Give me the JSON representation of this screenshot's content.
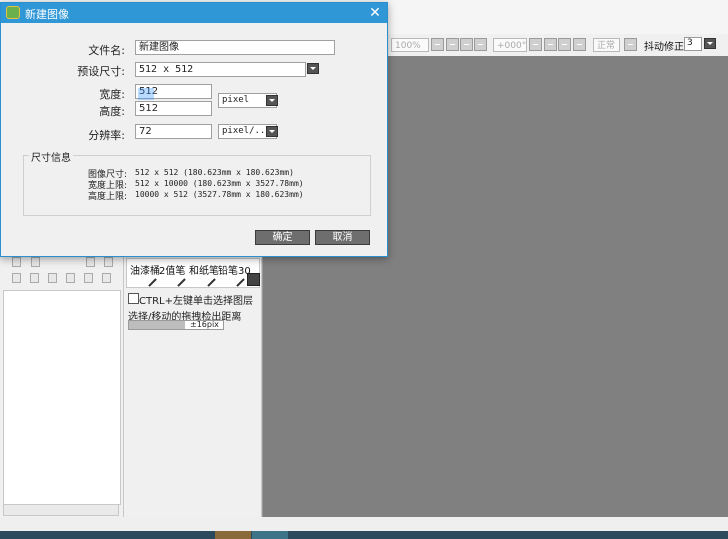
{
  "background": {
    "toolbar": {
      "zoom_value": "100%",
      "angle_value": "+000°",
      "mode_label": "正常",
      "stabilizer_label": "抖动修正",
      "stabilizer_value": "3"
    },
    "tool_labels": [
      "油漆桶",
      "2值笔",
      "和纸笔",
      "铅笔30"
    ],
    "ctrl_click_label": "CTRL+左键单击选择图层",
    "drag_distance_label": "选择/移动的拖拽检出距离",
    "drag_distance_value": "±16pix",
    "drag_distance_level": 0.6
  },
  "dialog": {
    "title": "新建图像",
    "close_glyph": "✕",
    "filename_label": "文件名:",
    "filename_value": "新建图像",
    "preset_label": "预设尺寸:",
    "preset_value": "512 x  512",
    "width_label": "宽度:",
    "width_value": "512",
    "height_label": "高度:",
    "height_value": "512",
    "unit_value": "pixel",
    "resolution_label": "分辨率:",
    "resolution_value": "72",
    "resolution_unit_value": "pixel/...",
    "size_info": {
      "title": "尺寸信息",
      "rows": [
        {
          "label": "图像尺寸:",
          "value": "512 x 512 (180.623mm x 180.623mm)"
        },
        {
          "label": "宽度上限:",
          "value": "512 x 10000 (180.623mm x 3527.78mm)"
        },
        {
          "label": "高度上限:",
          "value": "10000 x 512 (3527.78mm x 180.623mm)"
        }
      ]
    },
    "ok_label": "确定",
    "cancel_label": "取消"
  },
  "colors": {
    "title_bar": "#2f97d6",
    "canvas": "#808080",
    "button": "#6e6e6e"
  }
}
